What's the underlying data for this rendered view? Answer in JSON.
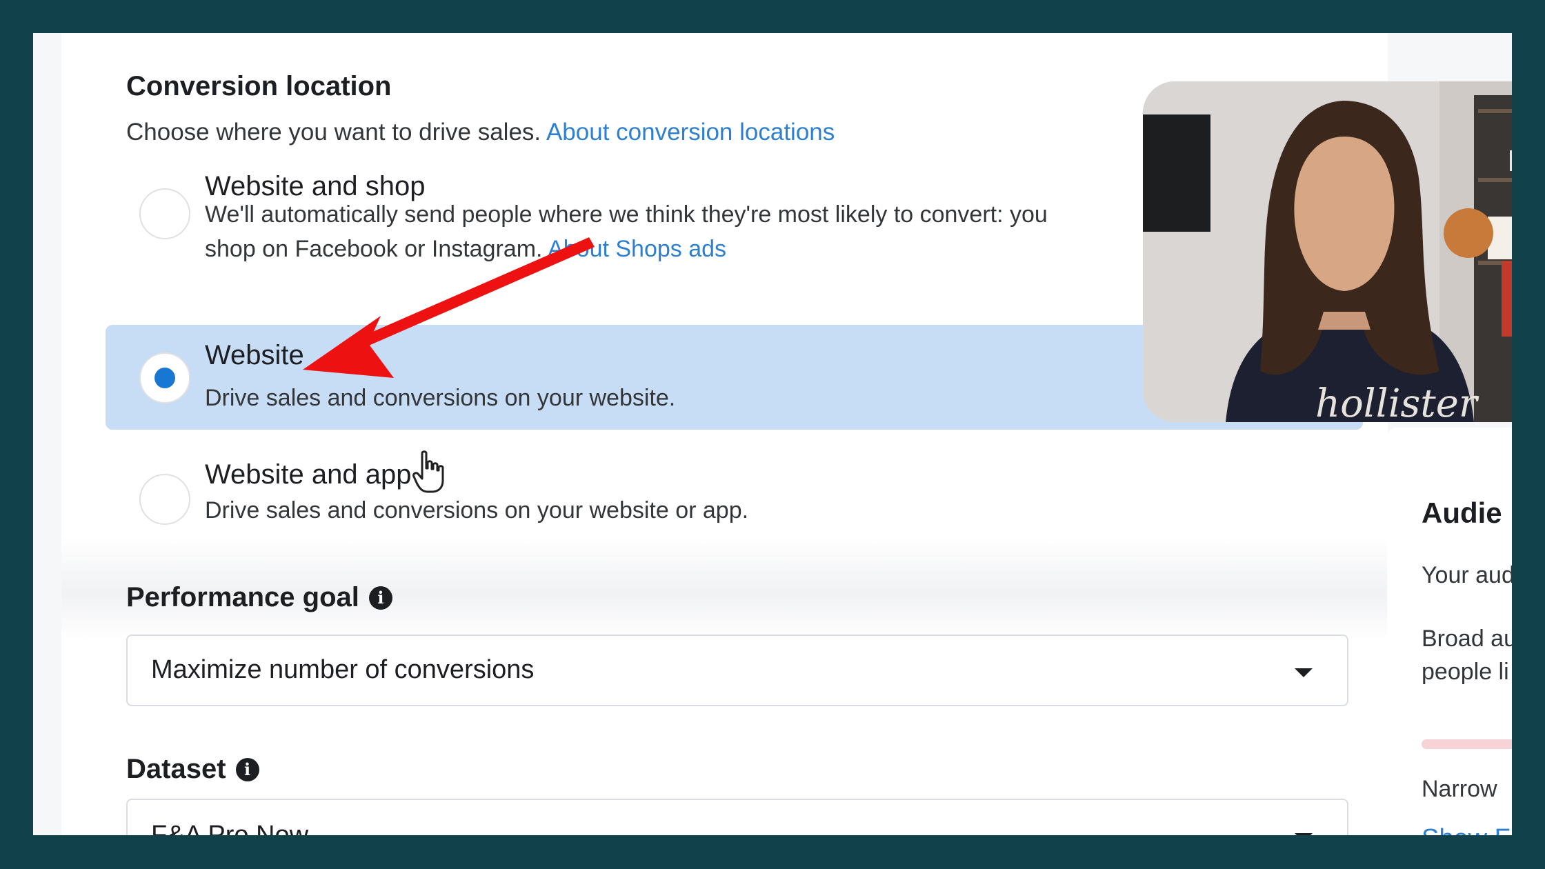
{
  "conversion_location": {
    "title": "Conversion location",
    "subtitle": "Choose where you want to drive sales.",
    "subtitle_link": "About conversion locations",
    "options": [
      {
        "title": "Website and shop",
        "desc_line1": "We'll automatically send people where we think they're most likely to convert: you",
        "desc_line2": "shop on Facebook or Instagram.",
        "desc_link": "About Shops ads",
        "selected": false
      },
      {
        "title": "Website",
        "desc_line1": "Drive sales and conversions on your website.",
        "selected": true
      },
      {
        "title": "Website and app",
        "desc_line1": "Drive sales and conversions on your website or app.",
        "selected": false
      }
    ]
  },
  "performance_goal": {
    "label": "Performance goal",
    "value": "Maximize number of conversions"
  },
  "dataset": {
    "label": "Dataset",
    "value": "F&A Pro Now"
  },
  "audience_panel": {
    "title": "Audie",
    "line1": "Your aud",
    "line2": "Broad au",
    "line3": "people li",
    "narrow_label": "Narrow",
    "show_link": "Show F"
  },
  "webcam": {
    "shirt_text": "hollister"
  },
  "colors": {
    "frame": "#11414a",
    "selected_bg": "#c7dcf5",
    "link": "#2d7fd0",
    "radio_checked": "#1877d2",
    "annotation_arrow": "#ee1111"
  }
}
